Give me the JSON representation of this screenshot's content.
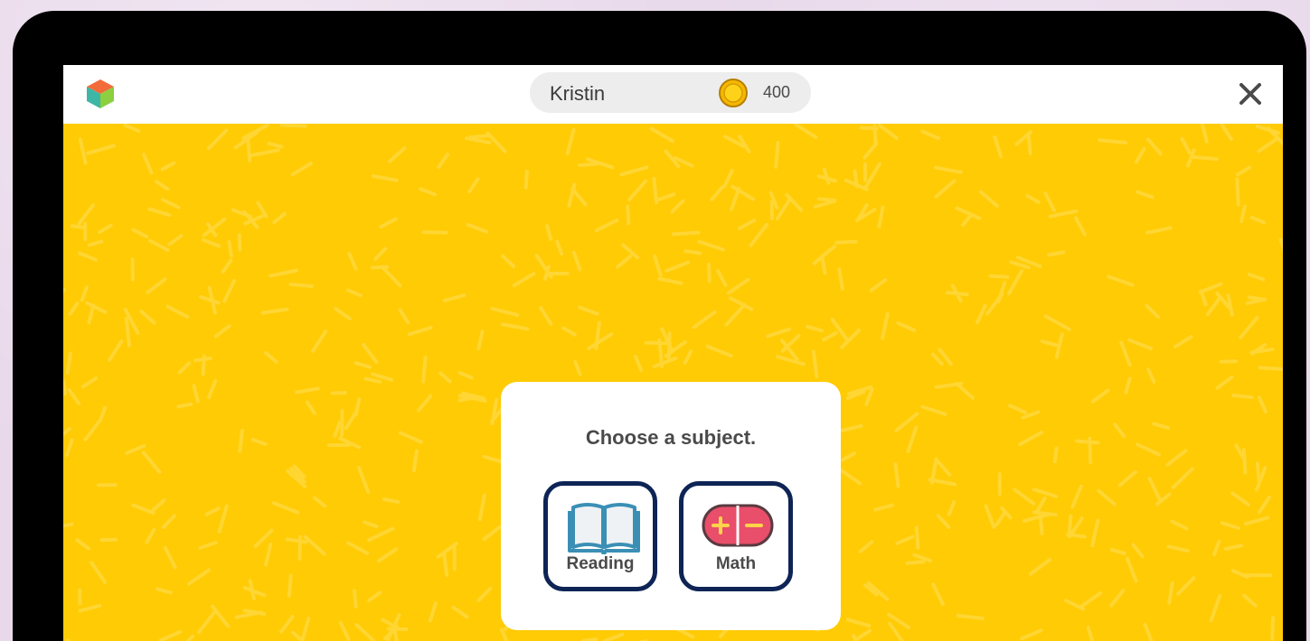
{
  "header": {
    "user_name": "Kristin",
    "coins": "400"
  },
  "main": {
    "prompt": "Choose a subject.",
    "subjects": [
      {
        "label": "Reading",
        "icon": "open-book-icon"
      },
      {
        "label": "Math",
        "icon": "plus-minus-icon"
      }
    ]
  },
  "colors": {
    "background_yellow": "#ffcb05",
    "button_border": "#0d2455",
    "math_icon": "#e94e6a",
    "reading_icon": "#3b8fb5",
    "coin": "#f5b800"
  },
  "icons": {
    "logo": "cube-logo-icon",
    "coin": "coin-icon",
    "close": "close-icon"
  }
}
